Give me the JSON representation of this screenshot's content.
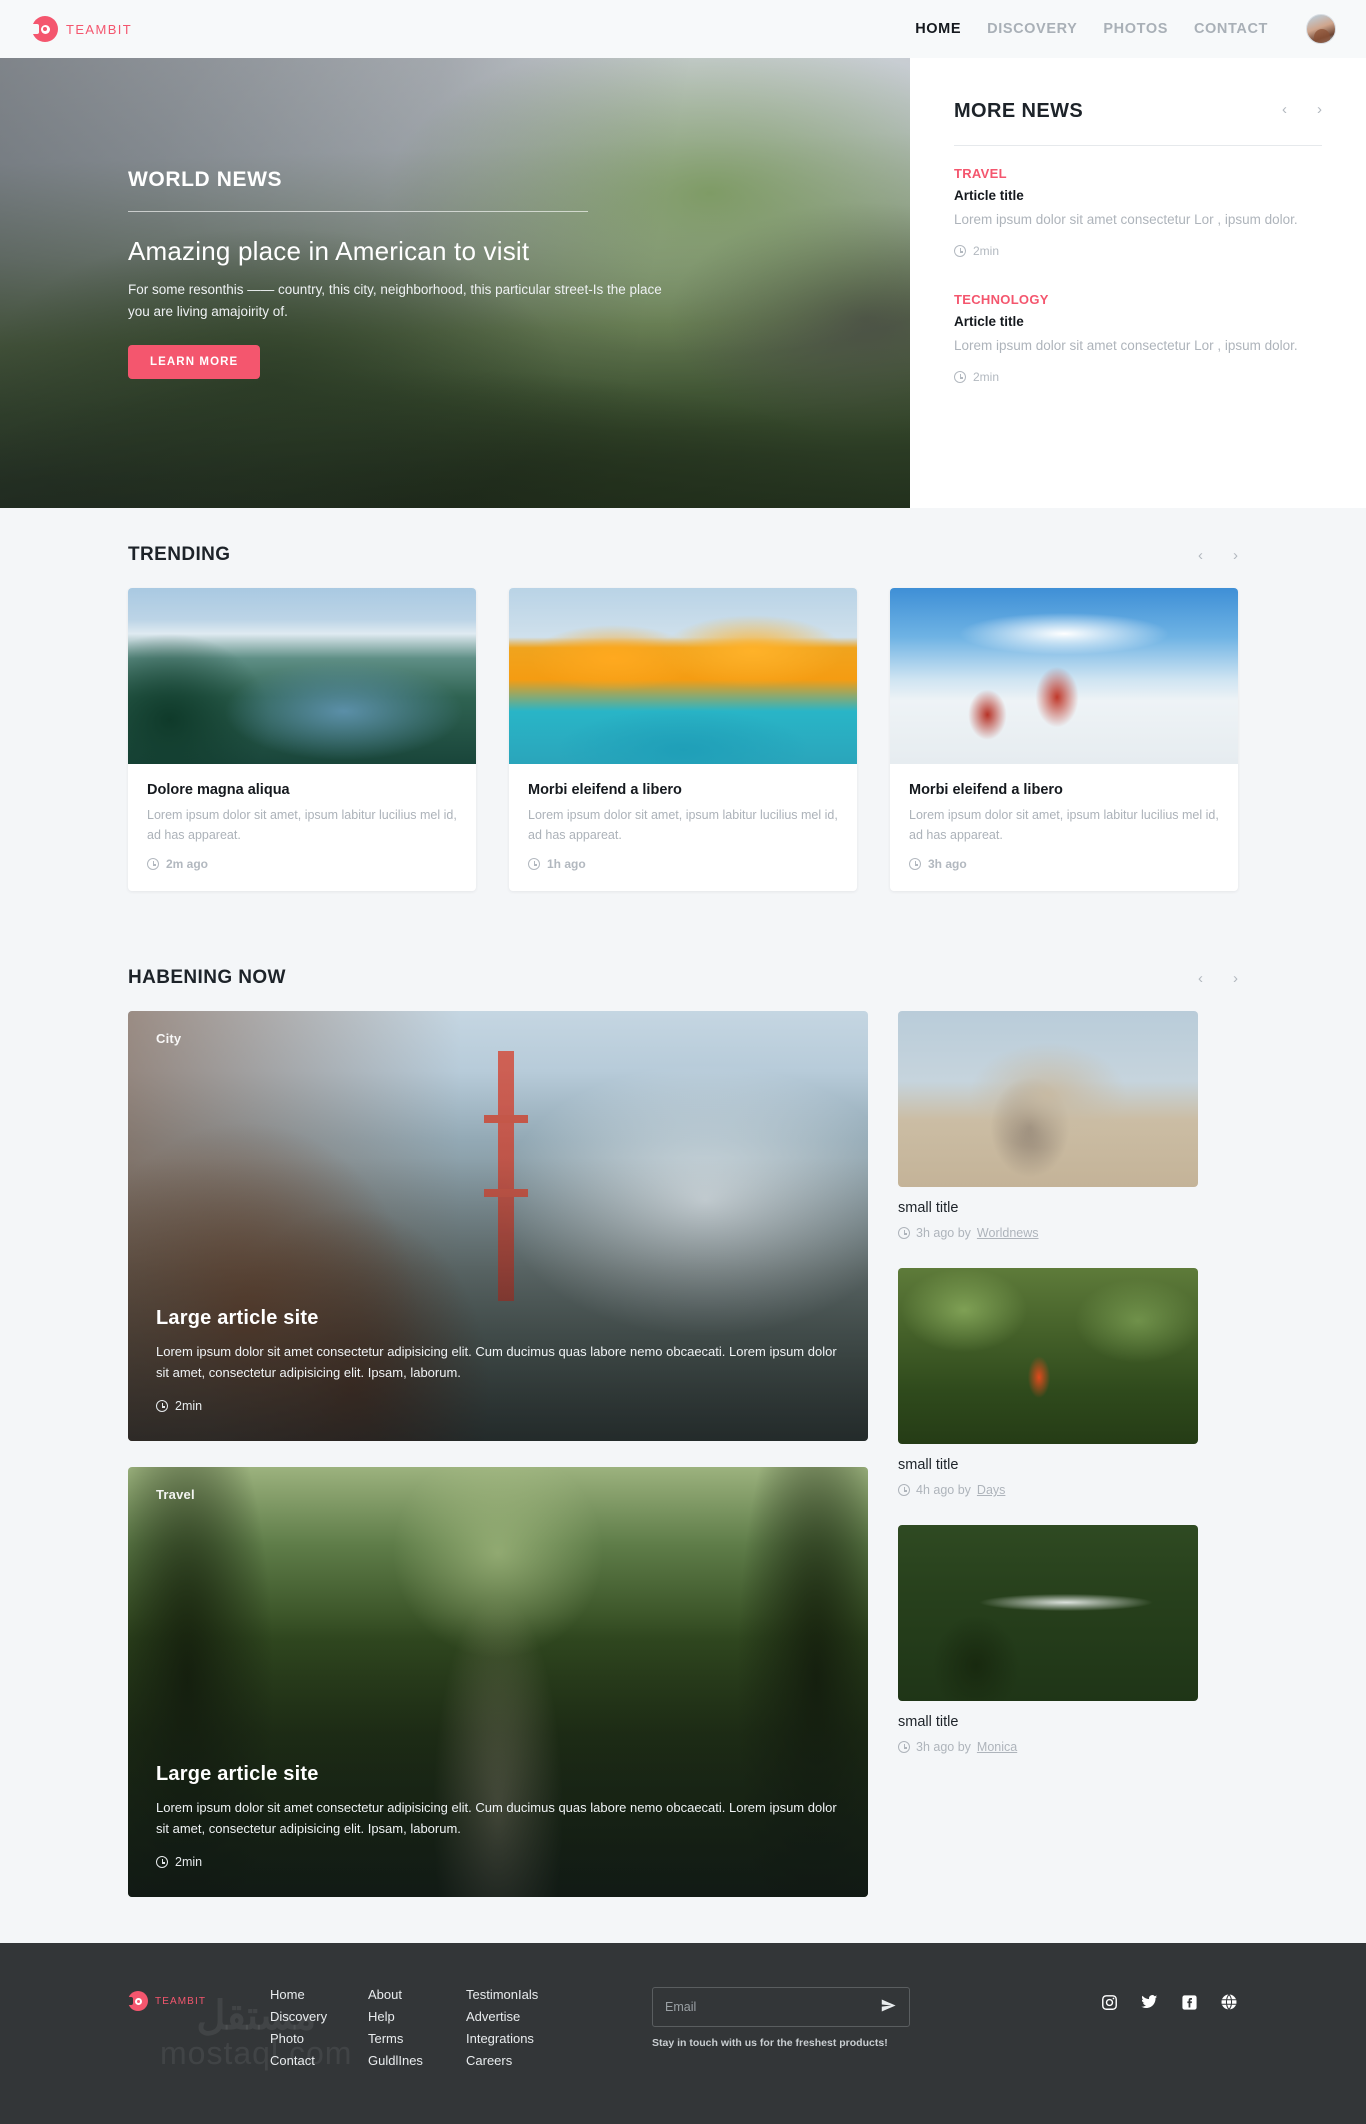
{
  "brand": {
    "name": "TEAMBIT",
    "color": "#f4566e"
  },
  "header": {
    "nav": [
      {
        "label": "HOME",
        "active": true
      },
      {
        "label": "DISCOVERY",
        "active": false
      },
      {
        "label": "PHOTOS",
        "active": false
      },
      {
        "label": "CONTACT",
        "active": false
      }
    ]
  },
  "hero": {
    "kicker": "WORLD NEWS",
    "title": "Amazing place in American to visit",
    "description": "For some resonthis —— country, this city, neighborhood, this particular street-Is the place you are living amajoirity of.",
    "button": "LEARN MORE"
  },
  "more_news": {
    "title": "MORE NEWS",
    "prev": "‹",
    "next": "›",
    "items": [
      {
        "category": "TRAVEL",
        "title": "Article title",
        "text": "Lorem ipsum dolor sit amet consectetur Lor , ipsum dolor.",
        "time": "2min"
      },
      {
        "category": "TECHNOLOGY",
        "title": "Article title",
        "text": "Lorem ipsum dolor sit amet consectetur Lor , ipsum dolor.",
        "time": "2min"
      }
    ]
  },
  "trending": {
    "title": "TRENDING",
    "prev": "‹",
    "next": "›",
    "cards": [
      {
        "title": "Dolore magna aliqua",
        "text": "Lorem ipsum dolor sit amet, ipsum labitur lucilius mel id, ad has appareat.",
        "time": "2m ago"
      },
      {
        "title": "Morbi eleifend a libero",
        "text": "Lorem ipsum dolor sit amet, ipsum labitur lucilius mel id, ad has appareat.",
        "time": "1h ago"
      },
      {
        "title": "Morbi eleifend a libero",
        "text": "Lorem ipsum dolor sit amet, ipsum labitur lucilius mel id, ad has appareat.",
        "time": "3h ago"
      }
    ]
  },
  "happening": {
    "title": "HABENING NOW",
    "prev": "‹",
    "next": "›",
    "big_cards": [
      {
        "tag": "City",
        "title": "Large article site",
        "text": "Lorem ipsum dolor sit amet consectetur adipisicing elit. Cum ducimus quas labore nemo obcaecati. Lorem ipsum dolor sit amet, consectetur adipisicing elit. Ipsam, laborum.",
        "time": "2min"
      },
      {
        "tag": "Travel",
        "title": "Large article site",
        "text": "Lorem ipsum dolor sit amet consectetur adipisicing elit. Cum ducimus quas labore nemo obcaecati. Lorem ipsum dolor sit amet, consectetur adipisicing elit. Ipsam, laborum.",
        "time": "2min"
      }
    ],
    "small_cards": [
      {
        "title": "small title",
        "time": "3h ago by",
        "author": "Worldnews"
      },
      {
        "title": "small title",
        "time": "4h ago by",
        "author": "Days"
      },
      {
        "title": "small title",
        "time": "3h ago by",
        "author": "Monica"
      }
    ]
  },
  "footer": {
    "columns": [
      {
        "links": [
          "Home",
          "Discovery",
          "Photo",
          "Contact"
        ]
      },
      {
        "links": [
          "About",
          "Help",
          "Terms",
          "GuldlInes"
        ]
      },
      {
        "links": [
          "TestimonIals",
          "Advertise",
          "Integrations",
          "Careers"
        ]
      }
    ],
    "newsletter": {
      "placeholder": "Email",
      "value": "",
      "note": "Stay in touch with us for the freshest products!"
    },
    "social": [
      "instagram-icon",
      "twitter-icon",
      "facebook-icon",
      "globe-icon"
    ],
    "watermark_line1": "مستقل",
    "watermark_line2": "mostaql.com"
  }
}
